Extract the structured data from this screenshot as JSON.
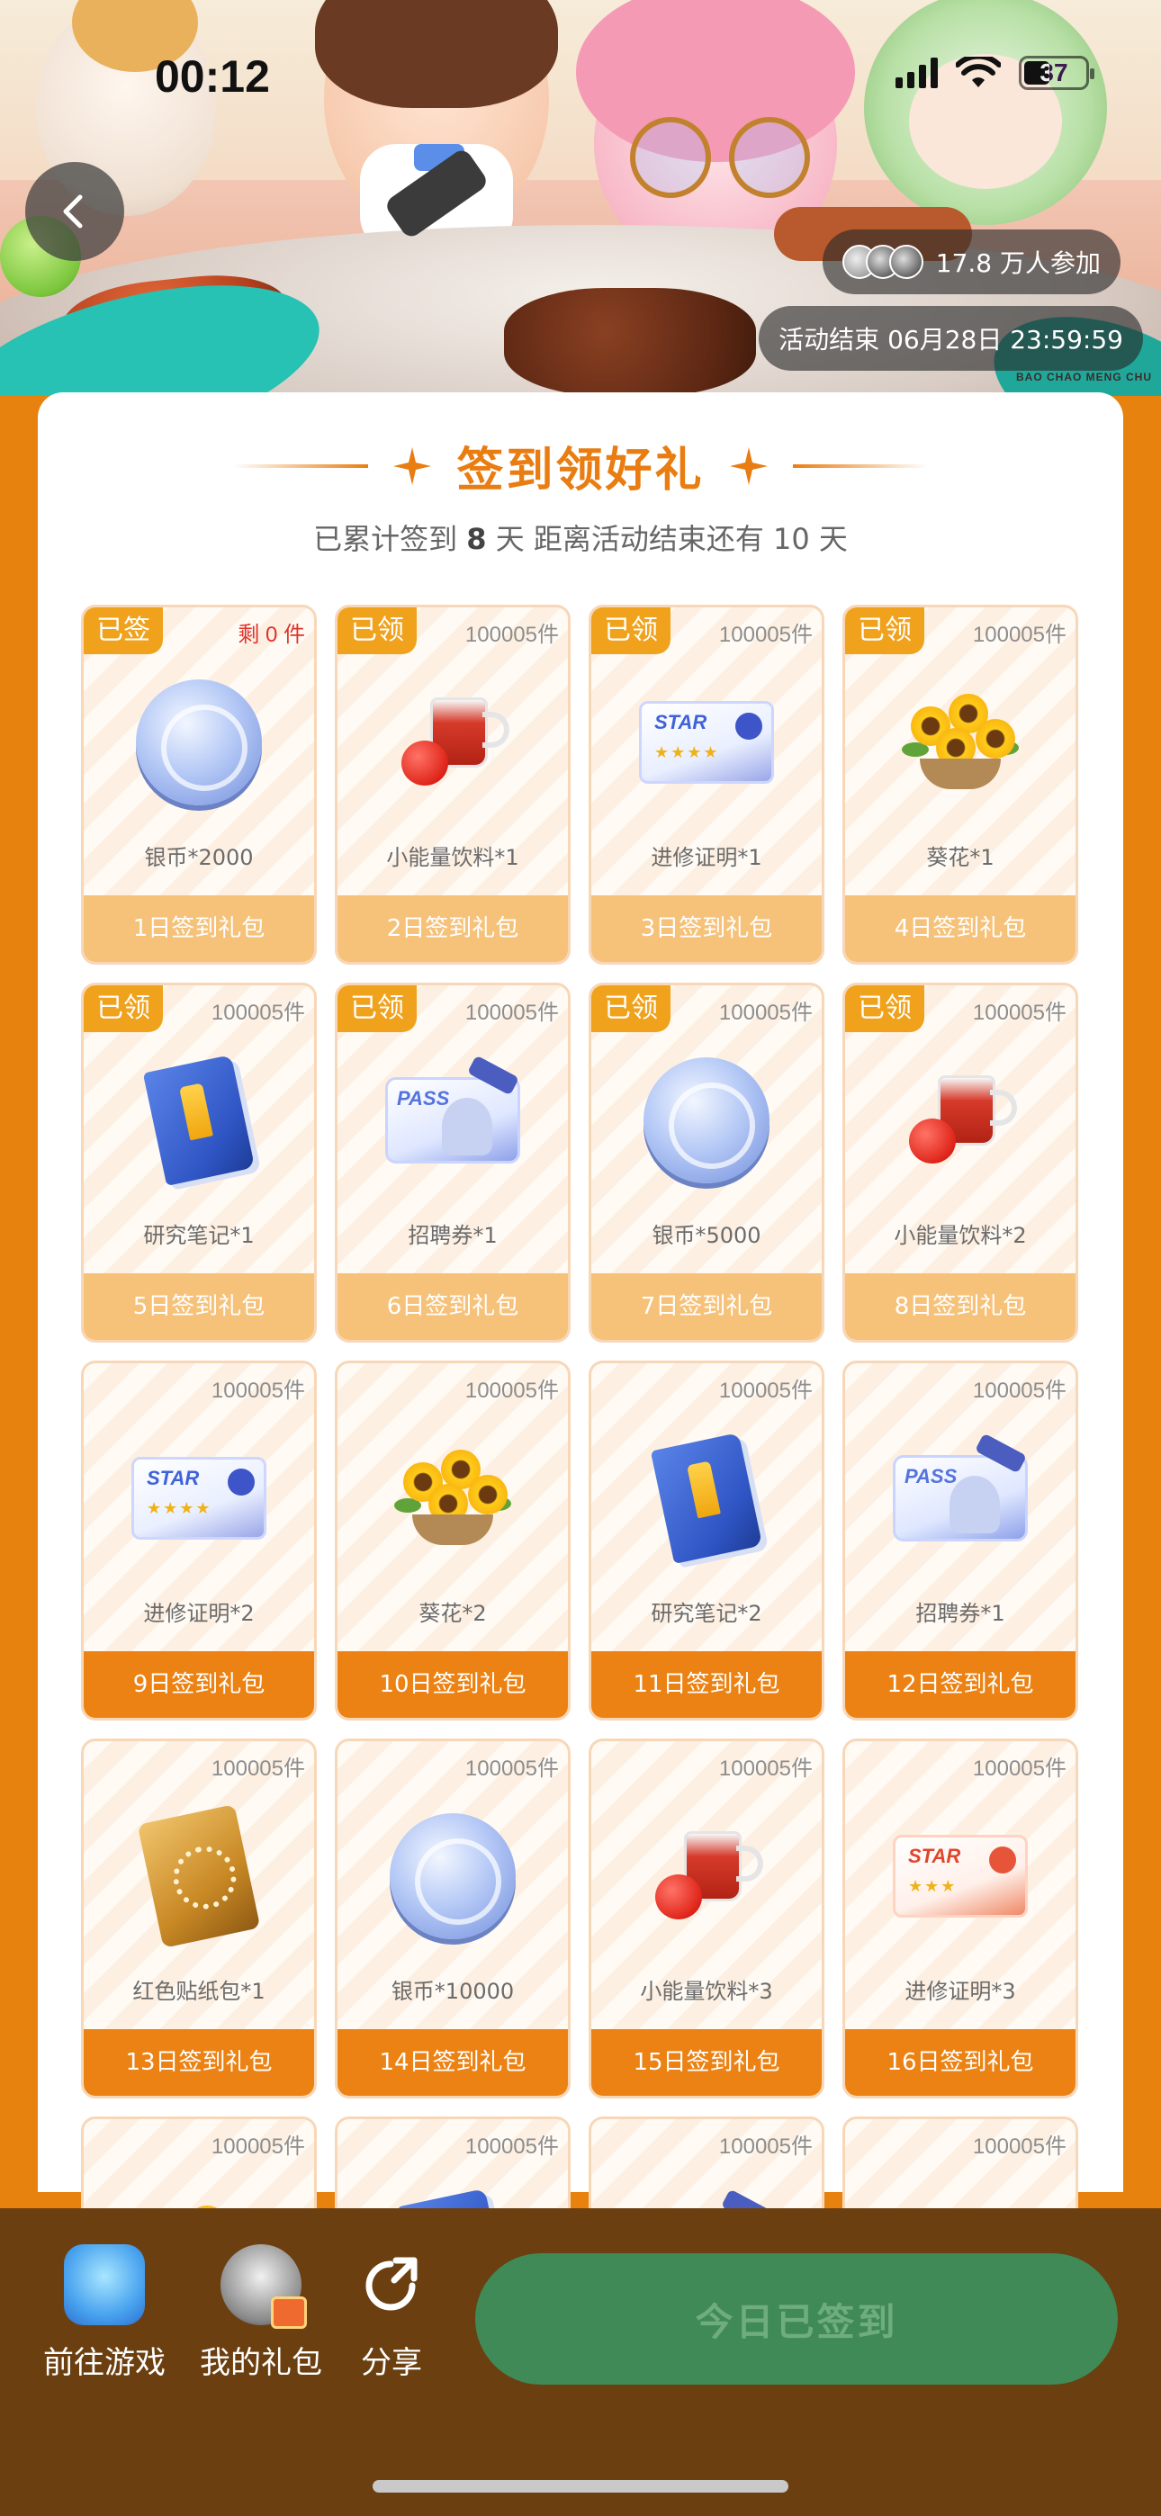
{
  "status_bar": {
    "time": "00:12",
    "battery": "37"
  },
  "banner": {
    "participants": "17.8 万人参加",
    "end_time": "活动结束 06月28日 23:59:59",
    "logo_text": "BAO CHAO MENG CHU"
  },
  "card": {
    "title": "签到领好礼",
    "subtitle_prefix": "已累计签到",
    "days_signed": "8",
    "subtitle_mid": "天   距离活动结束还有 10 天"
  },
  "gifts": [
    {
      "tag": "已签",
      "count": "剩 0 件",
      "name": "银币*2000",
      "footer": "1日签到礼包"
    },
    {
      "tag": "已领",
      "count": "100005件",
      "name": "小能量饮料*1",
      "footer": "2日签到礼包"
    },
    {
      "tag": "已领",
      "count": "100005件",
      "name": "进修证明*1",
      "footer": "3日签到礼包"
    },
    {
      "tag": "已领",
      "count": "100005件",
      "name": "葵花*1",
      "footer": "4日签到礼包"
    },
    {
      "tag": "已领",
      "count": "100005件",
      "name": "研究笔记*1",
      "footer": "5日签到礼包"
    },
    {
      "tag": "已领",
      "count": "100005件",
      "name": "招聘券*1",
      "footer": "6日签到礼包"
    },
    {
      "tag": "已领",
      "count": "100005件",
      "name": "银币*5000",
      "footer": "7日签到礼包"
    },
    {
      "tag": "已领",
      "count": "100005件",
      "name": "小能量饮料*2",
      "footer": "8日签到礼包"
    },
    {
      "tag": "",
      "count": "100005件",
      "name": "进修证明*2",
      "footer": "9日签到礼包"
    },
    {
      "tag": "",
      "count": "100005件",
      "name": "葵花*2",
      "footer": "10日签到礼包"
    },
    {
      "tag": "",
      "count": "100005件",
      "name": "研究笔记*2",
      "footer": "11日签到礼包"
    },
    {
      "tag": "",
      "count": "100005件",
      "name": "招聘券*1",
      "footer": "12日签到礼包"
    },
    {
      "tag": "",
      "count": "100005件",
      "name": "红色贴纸包*1",
      "footer": "13日签到礼包"
    },
    {
      "tag": "",
      "count": "100005件",
      "name": "银币*10000",
      "footer": "14日签到礼包"
    },
    {
      "tag": "",
      "count": "100005件",
      "name": "小能量饮料*3",
      "footer": "15日签到礼包"
    },
    {
      "tag": "",
      "count": "100005件",
      "name": "进修证明*3",
      "footer": "16日签到礼包"
    },
    {
      "tag": "",
      "count": "100005件",
      "name": "",
      "footer": ""
    },
    {
      "tag": "",
      "count": "100005件",
      "name": "",
      "footer": ""
    },
    {
      "tag": "",
      "count": "100005件",
      "name": "",
      "footer": ""
    },
    {
      "tag": "",
      "count": "100005件",
      "name": "",
      "footer": ""
    }
  ],
  "bottom_bar": {
    "go_game": "前往游戏",
    "my_gifts": "我的礼包",
    "share": "分享",
    "signed_button": "今日已签到"
  }
}
